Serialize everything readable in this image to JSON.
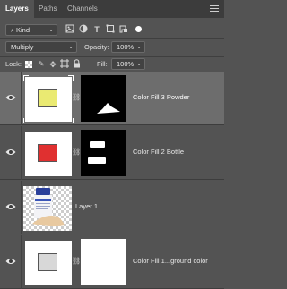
{
  "tabs": [
    {
      "label": "Layers",
      "active": true
    },
    {
      "label": "Paths",
      "active": false
    },
    {
      "label": "Channels",
      "active": false
    }
  ],
  "filter": {
    "kind_label": "Kind",
    "icon": "search-icon"
  },
  "blend": {
    "mode": "Multiply",
    "opacity_label": "Opacity:",
    "opacity_value": "100%"
  },
  "lock": {
    "label": "Lock:",
    "fill_label": "Fill:",
    "fill_value": "100%"
  },
  "layers": [
    {
      "name": "Color Fill 3 Powder",
      "swatch_color": "#eaea72",
      "selected": true
    },
    {
      "name": "Color Fill 2 Bottle",
      "swatch_color": "#e03030",
      "selected": false
    },
    {
      "name": "Layer 1",
      "selected": false
    },
    {
      "name": "Color Fill 1...ground color",
      "swatch_color": "#d8d8d8",
      "selected": false
    }
  ],
  "colors": {
    "panel_bg": "#535353",
    "selected_row": "#6d6d6d",
    "tab_bar": "#3c3c3c"
  }
}
